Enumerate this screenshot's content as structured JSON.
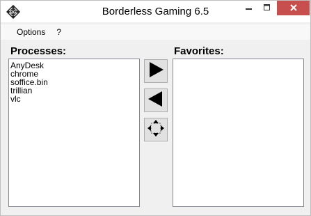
{
  "window": {
    "title": "Borderless Gaming 6.5"
  },
  "menu": {
    "items": [
      "Options",
      "?"
    ]
  },
  "processes": {
    "label": "Processes:",
    "items": [
      "AnyDesk",
      "chrome",
      "soffice.bin",
      "trillian",
      "vlc"
    ]
  },
  "favorites": {
    "label": "Favorites:",
    "items": []
  },
  "colors": {
    "titlebar_bg": "#ffffff",
    "close_button_bg": "#c7504f",
    "window_bg": "#f0f0f0",
    "list_bg": "#ffffff"
  },
  "icons": {
    "app": "bg-logo-icon",
    "add_to_favorites": "arrow-right-icon",
    "remove_from_favorites": "arrow-left-icon",
    "make_borderless": "fullscreen-arrows-icon"
  }
}
